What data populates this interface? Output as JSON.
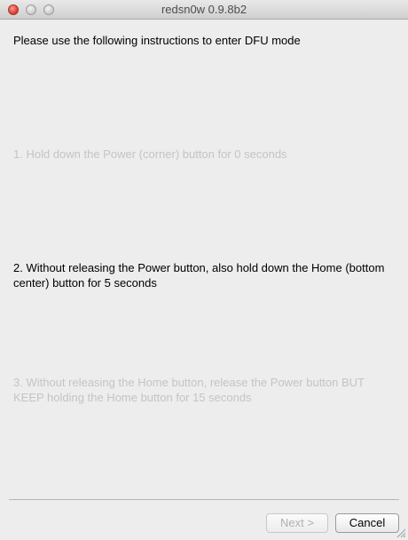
{
  "window": {
    "title": "redsn0w 0.9.8b2"
  },
  "instructions": {
    "heading": "Please use the following instructions to enter DFU mode",
    "steps": [
      {
        "text": "1. Hold down the Power (corner) button for 0 seconds",
        "state": "inactive"
      },
      {
        "text": "2. Without releasing the Power button, also hold down the Home (bottom center) button for 5 seconds",
        "state": "active"
      },
      {
        "text": "3. Without releasing the Home button, release the Power button BUT KEEP holding the Home button for 15 seconds",
        "state": "inactive"
      }
    ]
  },
  "buttons": {
    "next_label": "Next >",
    "cancel_label": "Cancel"
  },
  "colors": {
    "active_text": "#000000",
    "inactive_text": "#c4c4c4",
    "close_button": "#e0433a"
  }
}
